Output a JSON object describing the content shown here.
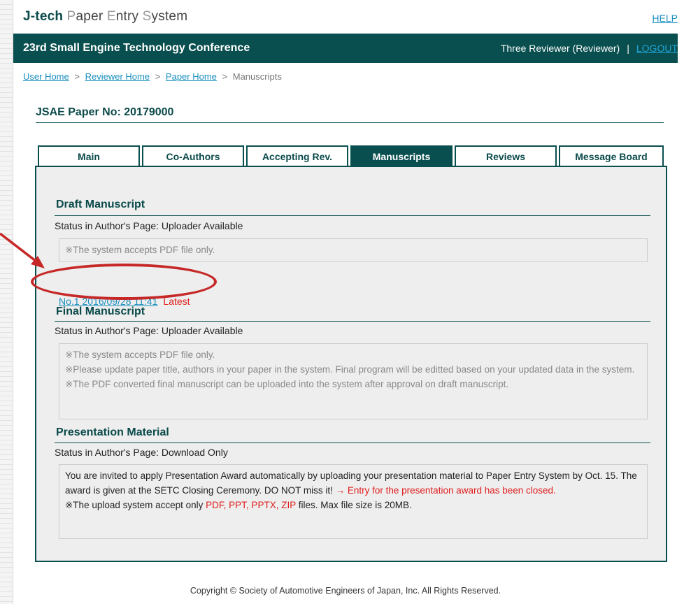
{
  "header": {
    "brand": "J-tech",
    "title_rest_parts": [
      " ",
      "P",
      "aper ",
      "E",
      "ntry ",
      "S",
      "ystem"
    ],
    "help_label": "HELP",
    "conference": "23rd Small Engine Technology Conference",
    "user": "Three Reviewer (Reviewer)",
    "separator": "|",
    "logout_label": "LOGOUT"
  },
  "breadcrumb": {
    "items": [
      "User Home",
      "Reviewer Home",
      "Paper Home"
    ],
    "current": "Manuscripts",
    "sep": ">"
  },
  "paper": {
    "label": "JSAE Paper No: 20179000"
  },
  "tabs": [
    {
      "label": "Main",
      "active": false
    },
    {
      "label": "Co-Authors",
      "active": false
    },
    {
      "label": "Accepting Rev.",
      "active": false
    },
    {
      "label": "Manuscripts",
      "active": true
    },
    {
      "label": "Reviews",
      "active": false
    },
    {
      "label": "Message Board",
      "active": false
    }
  ],
  "draft": {
    "title": "Draft Manuscript",
    "status": "Status in Author's Page: Uploader Available",
    "note": "※The system accepts PDF file only.",
    "file_link": "No.1 2016/09/28 11:41",
    "file_tag": "Latest"
  },
  "final": {
    "title": "Final Manuscript",
    "status": "Status in Author's Page: Uploader Available",
    "notes": [
      "※The system accepts PDF file only.",
      "※Please update paper title, authors in your paper in the system. Final program will be editted based on your updated data in the system.",
      "※The PDF converted final manuscript can be uploaded into the system after approval on draft manuscript."
    ]
  },
  "presentation": {
    "title": "Presentation Material",
    "status": "Status in Author's Page: Download Only",
    "text1": "You are invited to apply Presentation Award automatically by uploading your presentation material to Paper Entry System by Oct. 15. The award is given at the SETC Closing Ceremony. DO NOT miss it! ",
    "text1_red": "→ Entry for the presentation award has been closed.",
    "text2_pre": "※The upload system accept only ",
    "text2_red": "PDF, PPT, PPTX, ZIP",
    "text2_post": " files. Max file size is 20MB."
  },
  "footer": {
    "copyright": "Copyright © Society of Automotive Engineers of Japan, Inc. All Rights Reserved."
  },
  "colors": {
    "primary": "#0a4f4f",
    "link": "#1a8fc0",
    "alert": "#e01d1d",
    "annotation": "#c62828"
  }
}
